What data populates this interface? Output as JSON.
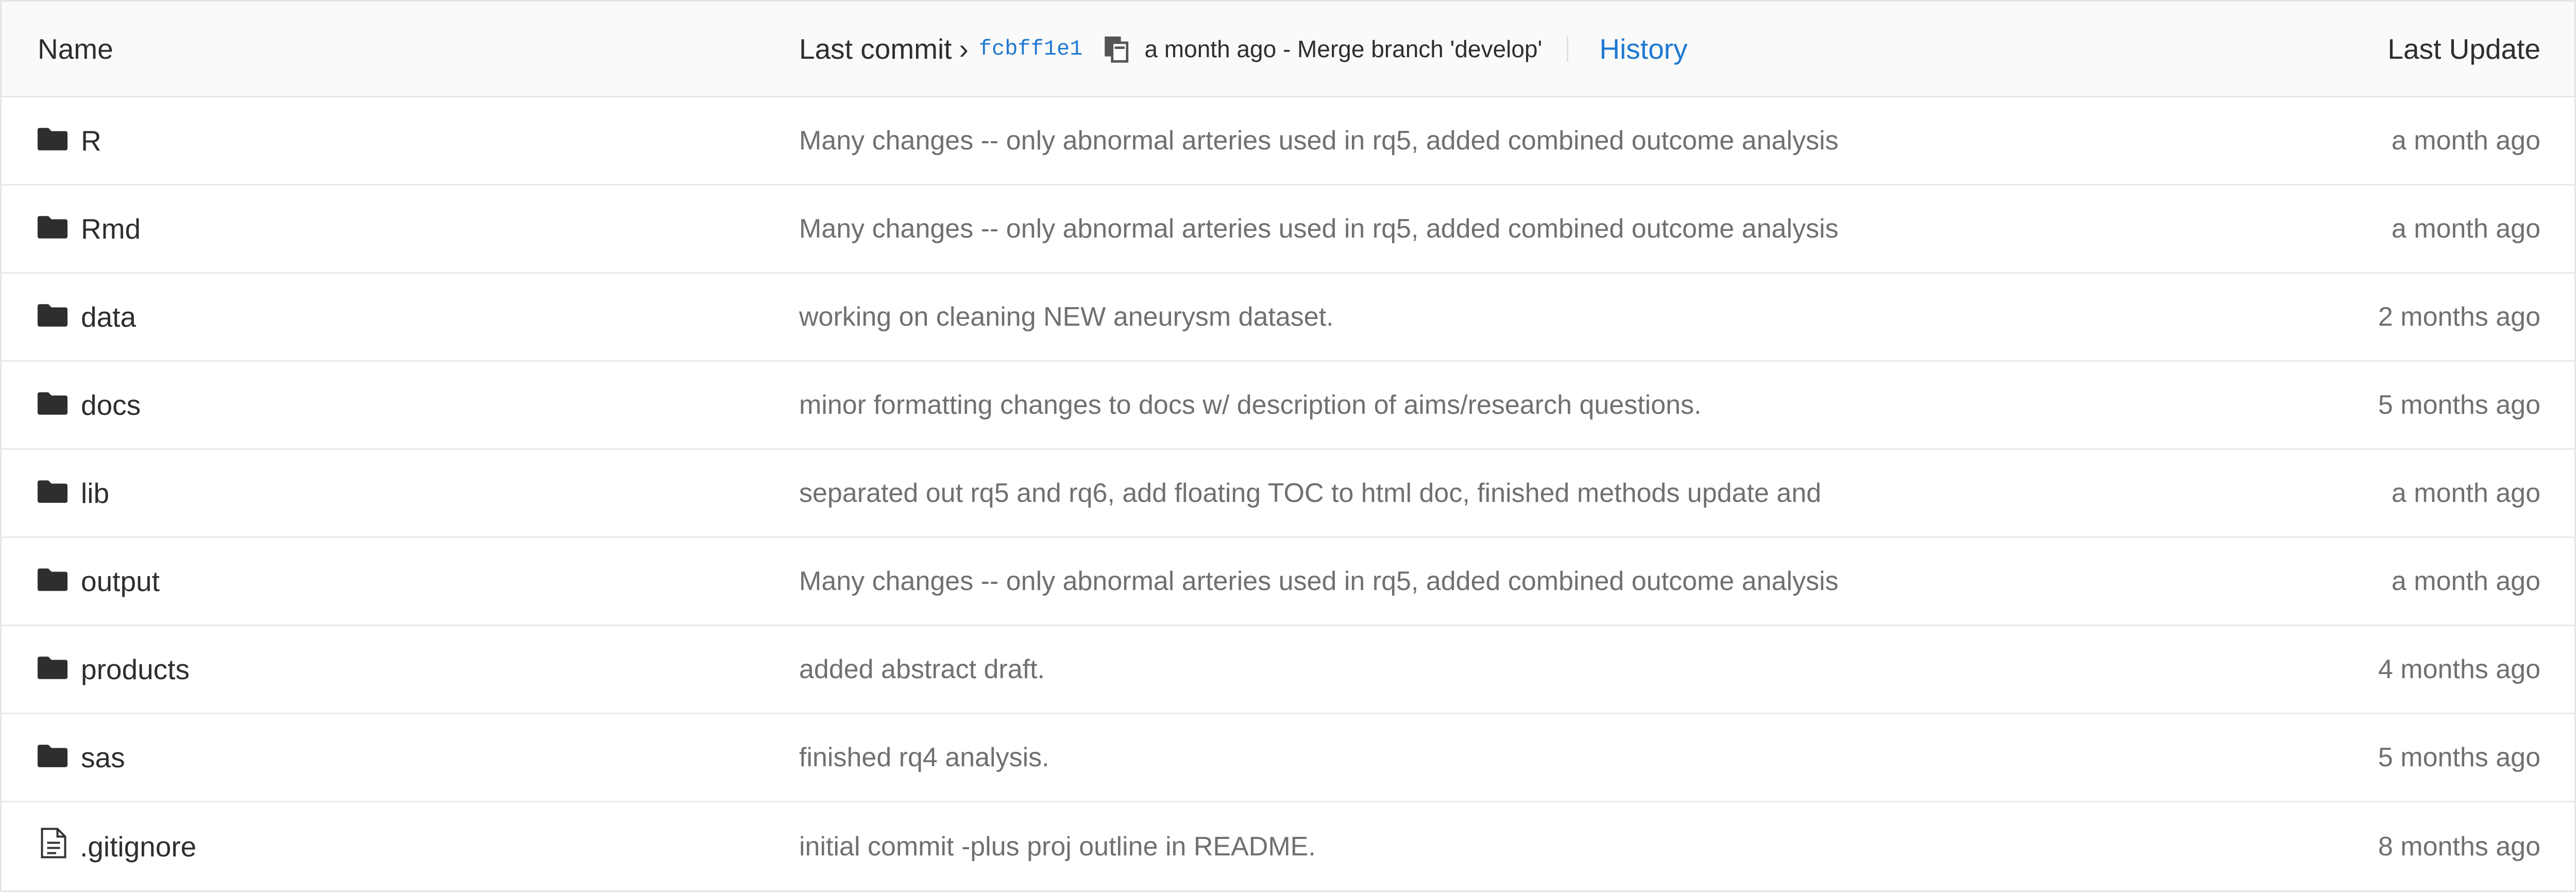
{
  "header": {
    "name_label": "Name",
    "last_commit_label": "Last commit",
    "chevron": "›",
    "sha": "fcbff1e1",
    "commit_meta": "a month ago - Merge branch 'develop'",
    "history_label": "History",
    "last_update_label": "Last Update"
  },
  "rows": [
    {
      "name": "R",
      "icon": "folder-icon",
      "message": "Many changes -- only abnormal arteries used in rq5, added combined outcome analysis",
      "updated": "a month ago"
    },
    {
      "name": "Rmd",
      "icon": "folder-icon",
      "message": "Many changes -- only abnormal arteries used in rq5, added combined outcome analysis",
      "updated": "a month ago"
    },
    {
      "name": "data",
      "icon": "folder-icon",
      "message": "working on cleaning NEW aneurysm dataset.",
      "updated": "2 months ago"
    },
    {
      "name": "docs",
      "icon": "folder-icon",
      "message": "minor formatting changes to docs w/ description of aims/research questions.",
      "updated": "5 months ago"
    },
    {
      "name": "lib",
      "icon": "folder-icon",
      "message": "separated out rq5 and rq6, add floating TOC to html doc, finished methods update and",
      "updated": "a month ago"
    },
    {
      "name": "output",
      "icon": "folder-icon",
      "message": "Many changes -- only abnormal arteries used in rq5, added combined outcome analysis",
      "updated": "a month ago"
    },
    {
      "name": "products",
      "icon": "folder-icon",
      "message": "added abstract draft.",
      "updated": "4 months ago"
    },
    {
      "name": "sas",
      "icon": "folder-icon",
      "message": "finished rq4 analysis.",
      "updated": "5 months ago"
    },
    {
      "name": ".gitignore",
      "icon": "file-text-icon",
      "message": "initial commit -plus proj outline in README.",
      "updated": "8 months ago"
    }
  ],
  "colors": {
    "link": "#1f78d1",
    "muted_text": "#707070",
    "header_bg": "#fafafa",
    "border": "#e5e5e5"
  }
}
